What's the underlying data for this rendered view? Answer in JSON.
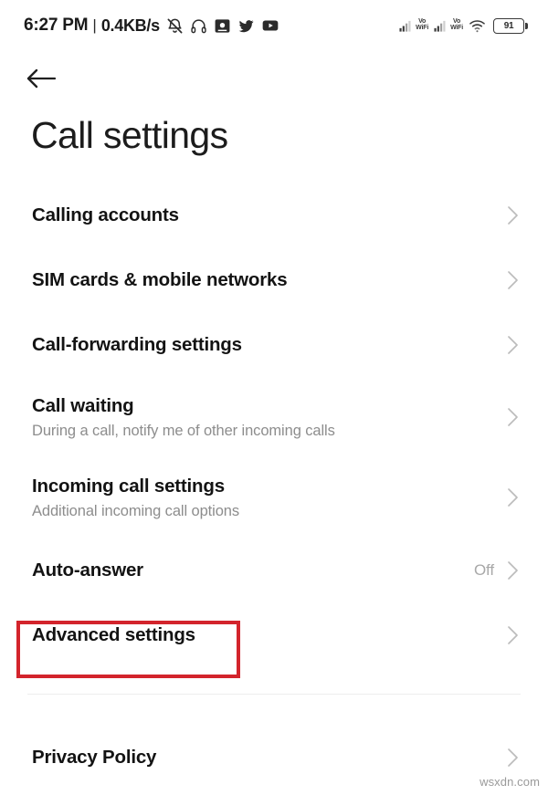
{
  "status_bar": {
    "time": "6:27 PM",
    "separator": "|",
    "data_rate": "0.4KB/s",
    "notification_icons": [
      "bell-muted-icon",
      "headphones-icon",
      "screenshot-app-icon",
      "twitter-icon",
      "youtube-icon"
    ],
    "signal_1_label_top": "Vo",
    "signal_1_label_bottom": "WiFi",
    "signal_2_label_top": "Vo",
    "signal_2_label_bottom": "WiFi",
    "wifi_icon": "wifi-icon",
    "battery_level": "91"
  },
  "header": {
    "back_icon": "back-arrow-icon",
    "title": "Call settings"
  },
  "settings": {
    "items": [
      {
        "title": "Calling accounts",
        "subtitle": "",
        "value": "",
        "highlighted": false
      },
      {
        "title": "SIM cards & mobile networks",
        "subtitle": "",
        "value": "",
        "highlighted": false
      },
      {
        "title": "Call-forwarding settings",
        "subtitle": "",
        "value": "",
        "highlighted": false
      },
      {
        "title": "Call waiting",
        "subtitle": "During a call, notify me of other incoming calls",
        "value": "",
        "highlighted": false
      },
      {
        "title": "Incoming call settings",
        "subtitle": "Additional incoming call options",
        "value": "",
        "highlighted": false
      },
      {
        "title": "Auto-answer",
        "subtitle": "",
        "value": "Off",
        "highlighted": false
      },
      {
        "title": "Advanced settings",
        "subtitle": "",
        "value": "",
        "highlighted": true
      }
    ],
    "footer_items": [
      {
        "title": "Privacy Policy",
        "subtitle": "",
        "value": ""
      }
    ]
  },
  "annotation": {
    "highlight_color": "#d3242c",
    "target_label": "Advanced settings"
  },
  "watermark": {
    "text": "wsxdn.com"
  }
}
